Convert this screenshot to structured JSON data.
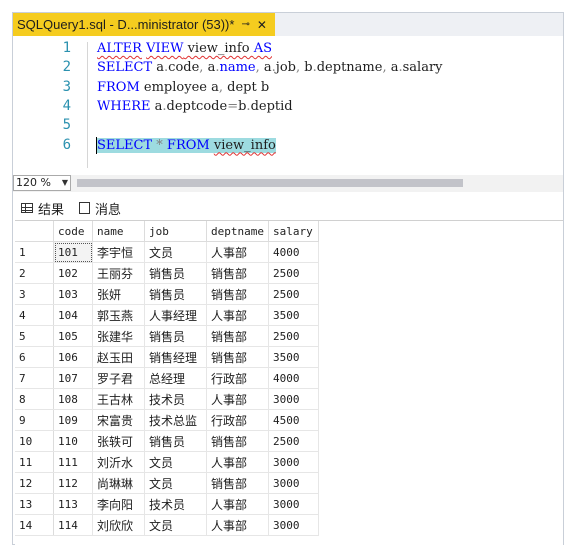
{
  "tab": {
    "title": "SQLQuery1.sql - D...ministrator (53))*",
    "pin_icon": "⊸",
    "close_icon": "✕"
  },
  "editor": {
    "lines": [
      {
        "num": "1",
        "tokens": [
          {
            "t": "ALTER",
            "c": "kw sq"
          },
          {
            "t": " ",
            "c": ""
          },
          {
            "t": "VIEW",
            "c": "kw sq"
          },
          {
            "t": " view_info ",
            "c": "sq"
          },
          {
            "t": "AS",
            "c": "kw sq"
          }
        ]
      },
      {
        "num": "2",
        "tokens": [
          {
            "t": "SELECT",
            "c": "kw"
          },
          {
            "t": " a",
            "c": ""
          },
          {
            "t": ".",
            "c": "op"
          },
          {
            "t": "code",
            "c": ""
          },
          {
            "t": ",",
            "c": "op"
          },
          {
            "t": " a",
            "c": ""
          },
          {
            "t": ".",
            "c": "op"
          },
          {
            "t": "name",
            "c": "kw"
          },
          {
            "t": ",",
            "c": "op"
          },
          {
            "t": " a",
            "c": ""
          },
          {
            "t": ".",
            "c": "op"
          },
          {
            "t": "job",
            "c": ""
          },
          {
            "t": ",",
            "c": "op"
          },
          {
            "t": " b",
            "c": ""
          },
          {
            "t": ".",
            "c": "op"
          },
          {
            "t": "deptname",
            "c": ""
          },
          {
            "t": ",",
            "c": "op"
          },
          {
            "t": " a",
            "c": ""
          },
          {
            "t": ".",
            "c": "op"
          },
          {
            "t": "salary",
            "c": ""
          }
        ]
      },
      {
        "num": "3",
        "tokens": [
          {
            "t": "FROM",
            "c": "kw"
          },
          {
            "t": " employee a",
            "c": ""
          },
          {
            "t": ",",
            "c": "op"
          },
          {
            "t": " dept b",
            "c": ""
          }
        ]
      },
      {
        "num": "4",
        "tokens": [
          {
            "t": "WHERE",
            "c": "kw"
          },
          {
            "t": " a",
            "c": ""
          },
          {
            "t": ".",
            "c": "op"
          },
          {
            "t": "deptcode",
            "c": ""
          },
          {
            "t": "=",
            "c": "op"
          },
          {
            "t": "b",
            "c": ""
          },
          {
            "t": ".",
            "c": "op"
          },
          {
            "t": "deptid",
            "c": ""
          }
        ]
      },
      {
        "num": "5",
        "tokens": []
      },
      {
        "num": "6",
        "tokens": [
          {
            "t": "SELECT",
            "c": "kw hl"
          },
          {
            "t": " ",
            "c": "hl"
          },
          {
            "t": "*",
            "c": "op hl"
          },
          {
            "t": " ",
            "c": "hl"
          },
          {
            "t": "FROM",
            "c": "kw hl"
          },
          {
            "t": " ",
            "c": "hl"
          },
          {
            "t": "view_info",
            "c": "hl sq"
          }
        ]
      }
    ]
  },
  "zoom": {
    "value": "120 %"
  },
  "result_tabs": [
    {
      "label": "结果",
      "icon": "grid-icon"
    },
    {
      "label": "消息",
      "icon": "message-icon"
    }
  ],
  "grid": {
    "columns": [
      "code",
      "name",
      "job",
      "deptname",
      "salary"
    ],
    "rows": [
      [
        "1",
        "101",
        "李宇恒",
        "文员",
        "人事部",
        "4000"
      ],
      [
        "2",
        "102",
        "王丽芬",
        "销售员",
        "销售部",
        "2500"
      ],
      [
        "3",
        "103",
        "张妍",
        "销售员",
        "销售部",
        "2500"
      ],
      [
        "4",
        "104",
        "郭玉燕",
        "人事经理",
        "人事部",
        "3500"
      ],
      [
        "5",
        "105",
        "张建华",
        "销售员",
        "销售部",
        "2500"
      ],
      [
        "6",
        "106",
        "赵玉田",
        "销售经理",
        "销售部",
        "3500"
      ],
      [
        "7",
        "107",
        "罗子君",
        "总经理",
        "行政部",
        "4000"
      ],
      [
        "8",
        "108",
        "王古林",
        "技术员",
        "人事部",
        "3000"
      ],
      [
        "9",
        "109",
        "宋富贵",
        "技术总监",
        "行政部",
        "4500"
      ],
      [
        "10",
        "110",
        "张轶可",
        "销售员",
        "销售部",
        "2500"
      ],
      [
        "11",
        "111",
        "刘沂水",
        "文员",
        "人事部",
        "3000"
      ],
      [
        "12",
        "112",
        "尚琳琳",
        "文员",
        "销售部",
        "3000"
      ],
      [
        "13",
        "113",
        "李向阳",
        "技术员",
        "人事部",
        "3000"
      ],
      [
        "14",
        "114",
        "刘欣欣",
        "文员",
        "人事部",
        "3000"
      ]
    ]
  },
  "colors": {
    "tab_active": "#f5cc1f",
    "keyword": "#0000ff",
    "line_number": "#2b91af",
    "selection": "#9ddbe0"
  }
}
